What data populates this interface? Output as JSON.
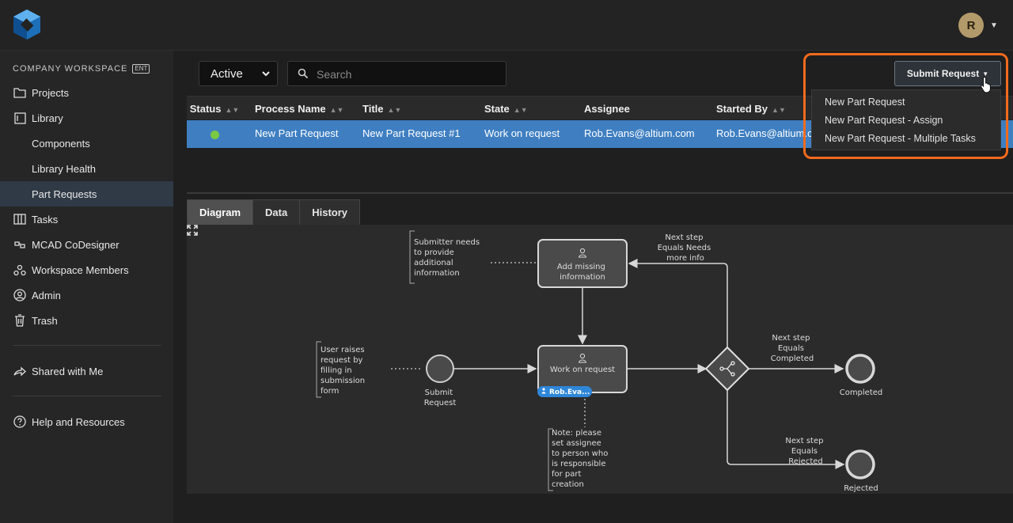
{
  "sidebar": {
    "workspace_label": "COMPANY WORKSPACE",
    "workspace_badge": "ENT",
    "items": [
      {
        "label": "Projects",
        "icon": "folder-icon"
      },
      {
        "label": "Library",
        "icon": "library-icon"
      },
      {
        "label": "Components"
      },
      {
        "label": "Library Health"
      },
      {
        "label": "Part Requests",
        "active": true
      },
      {
        "label": "Tasks",
        "icon": "tasks-icon"
      },
      {
        "label": "MCAD CoDesigner",
        "icon": "mcad-icon"
      },
      {
        "label": "Workspace Members",
        "icon": "members-icon"
      },
      {
        "label": "Admin",
        "icon": "admin-icon"
      },
      {
        "label": "Trash",
        "icon": "trash-icon"
      },
      {
        "label": "Shared with Me",
        "icon": "share-icon"
      },
      {
        "label": "Help and Resources",
        "icon": "help-icon"
      }
    ]
  },
  "header": {
    "avatar_initial": "R"
  },
  "toolbar": {
    "state_filter": "Active",
    "search_placeholder": "Search",
    "submit_label": "Submit Request",
    "submit_menu": [
      "New Part Request",
      "New Part Request - Assign",
      "New Part Request - Multiple Tasks"
    ]
  },
  "table": {
    "columns": [
      "Status",
      "Process Name",
      "Title",
      "State",
      "Assignee",
      "Started By"
    ],
    "rows": [
      {
        "status": "active",
        "process_name": "New Part Request",
        "title": "New Part Request #1",
        "state": "Work on request",
        "assignee": "Rob.Evans@altium.com",
        "started_by": "Rob.Evans@altium.c"
      }
    ]
  },
  "tabs": [
    "Diagram",
    "Data",
    "History"
  ],
  "diagram": {
    "annotations": {
      "submitter": [
        "Submitter needs",
        "to provide",
        "additional",
        "information"
      ],
      "user_raises": [
        "User raises",
        "request by",
        "filling in",
        "submission",
        "form"
      ],
      "note": [
        "Note: please",
        "set assignee",
        "to person who",
        "is responsible",
        "for part",
        "creation"
      ]
    },
    "tasks": {
      "add_missing": [
        "Add missing",
        "information"
      ],
      "work_on": "Work on request",
      "assignee_chip": "Rob.Eva..."
    },
    "events": {
      "submit": [
        "Submit",
        "Request"
      ],
      "completed": "Completed",
      "rejected": "Rejected"
    },
    "conditions": {
      "needs_info": [
        "Next step",
        "Equals Needs",
        "more info"
      ],
      "completed": [
        "Next step",
        "Equals",
        "Completed"
      ],
      "rejected": [
        "Next step",
        "Equals",
        "Rejected"
      ]
    }
  },
  "colors": {
    "accent": "#3f7fc1",
    "highlight": "#f26b1d",
    "status_active": "#7ac943"
  }
}
